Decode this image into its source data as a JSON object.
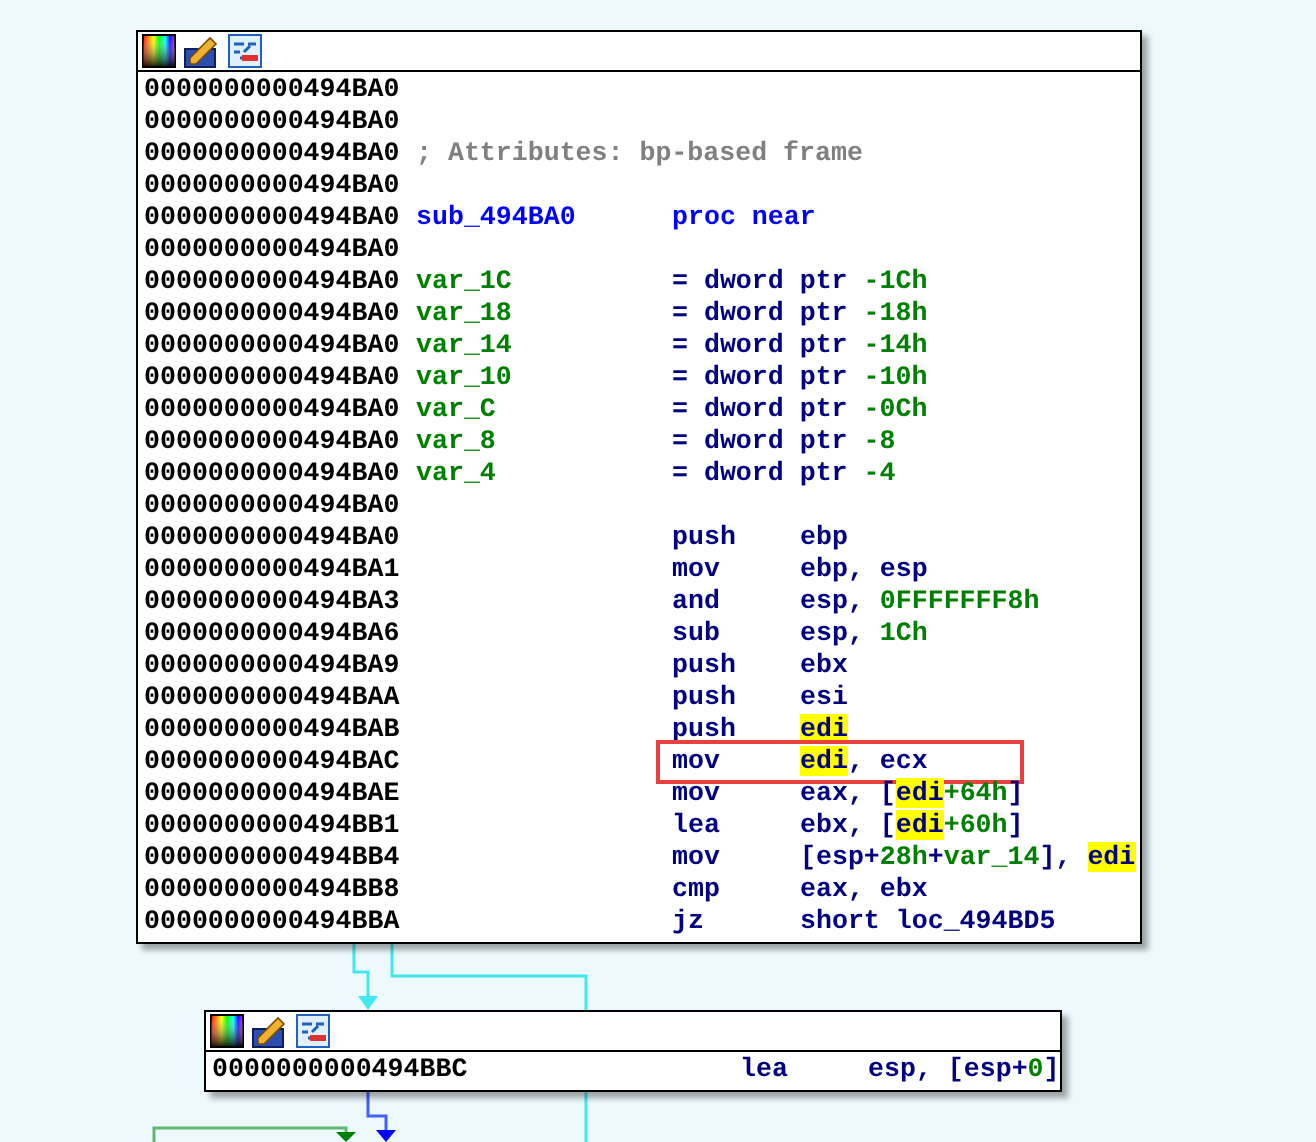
{
  "nodes": [
    {
      "lines": [
        {
          "kind": "blank",
          "address": "0000000000494BA0"
        },
        {
          "kind": "blank",
          "address": "0000000000494BA0"
        },
        {
          "kind": "comment",
          "address": "0000000000494BA0",
          "text": "; Attributes: bp-based frame"
        },
        {
          "kind": "blank",
          "address": "0000000000494BA0"
        },
        {
          "kind": "proc",
          "address": "0000000000494BA0",
          "label": "sub_494BA0",
          "directive": "proc near"
        },
        {
          "kind": "blank",
          "address": "0000000000494BA0"
        },
        {
          "kind": "var",
          "address": "0000000000494BA0",
          "label": "var_1C",
          "definition": "= dword ptr",
          "value": "-1Ch"
        },
        {
          "kind": "var",
          "address": "0000000000494BA0",
          "label": "var_18",
          "definition": "= dword ptr",
          "value": "-18h"
        },
        {
          "kind": "var",
          "address": "0000000000494BA0",
          "label": "var_14",
          "definition": "= dword ptr",
          "value": "-14h"
        },
        {
          "kind": "var",
          "address": "0000000000494BA0",
          "label": "var_10",
          "definition": "= dword ptr",
          "value": "-10h"
        },
        {
          "kind": "var",
          "address": "0000000000494BA0",
          "label": "var_C",
          "definition": "= dword ptr",
          "value": "-0Ch"
        },
        {
          "kind": "var",
          "address": "0000000000494BA0",
          "label": "var_8",
          "definition": "= dword ptr",
          "value": "-8"
        },
        {
          "kind": "var",
          "address": "0000000000494BA0",
          "label": "var_4",
          "definition": "= dword ptr",
          "value": "-4"
        },
        {
          "kind": "blank",
          "address": "0000000000494BA0"
        },
        {
          "kind": "insn",
          "address": "0000000000494BA0",
          "mnemonic": "push",
          "boxed": false,
          "operand": [
            {
              "kind": "reg",
              "text": "ebp",
              "highlighted": false
            }
          ]
        },
        {
          "kind": "insn",
          "address": "0000000000494BA1",
          "mnemonic": "mov",
          "boxed": false,
          "operand": [
            {
              "kind": "reg",
              "text": "ebp, esp",
              "highlighted": false
            }
          ]
        },
        {
          "kind": "insn",
          "address": "0000000000494BA3",
          "mnemonic": "and",
          "boxed": false,
          "operand": [
            {
              "kind": "reg",
              "text": "esp, ",
              "highlighted": false
            },
            {
              "kind": "num",
              "text": "0FFFFFFF8h",
              "highlighted": false
            }
          ]
        },
        {
          "kind": "insn",
          "address": "0000000000494BA6",
          "mnemonic": "sub",
          "boxed": false,
          "operand": [
            {
              "kind": "reg",
              "text": "esp, ",
              "highlighted": false
            },
            {
              "kind": "num",
              "text": "1Ch",
              "highlighted": false
            }
          ]
        },
        {
          "kind": "insn",
          "address": "0000000000494BA9",
          "mnemonic": "push",
          "boxed": false,
          "operand": [
            {
              "kind": "reg",
              "text": "ebx",
              "highlighted": false
            }
          ]
        },
        {
          "kind": "insn",
          "address": "0000000000494BAA",
          "mnemonic": "push",
          "boxed": false,
          "operand": [
            {
              "kind": "reg",
              "text": "esi",
              "highlighted": false
            }
          ]
        },
        {
          "kind": "insn",
          "address": "0000000000494BAB",
          "mnemonic": "push",
          "boxed": false,
          "operand": [
            {
              "kind": "reg",
              "text": "edi",
              "highlighted": true
            }
          ]
        },
        {
          "kind": "insn",
          "address": "0000000000494BAC",
          "mnemonic": "mov",
          "boxed": true,
          "operand": [
            {
              "kind": "reg",
              "text": "edi",
              "highlighted": true
            },
            {
              "kind": "reg",
              "text": ", ecx",
              "highlighted": false
            }
          ]
        },
        {
          "kind": "insn",
          "address": "0000000000494BAE",
          "mnemonic": "mov",
          "boxed": false,
          "operand": [
            {
              "kind": "reg",
              "text": "eax, [",
              "highlighted": false
            },
            {
              "kind": "reg",
              "text": "edi",
              "highlighted": true
            },
            {
              "kind": "num",
              "text": "+64h",
              "highlighted": false
            },
            {
              "kind": "reg",
              "text": "]",
              "highlighted": false
            }
          ]
        },
        {
          "kind": "insn",
          "address": "0000000000494BB1",
          "mnemonic": "lea",
          "boxed": false,
          "operand": [
            {
              "kind": "reg",
              "text": "ebx, [",
              "highlighted": false
            },
            {
              "kind": "reg",
              "text": "edi",
              "highlighted": true
            },
            {
              "kind": "num",
              "text": "+60h",
              "highlighted": false
            },
            {
              "kind": "reg",
              "text": "]",
              "highlighted": false
            }
          ]
        },
        {
          "kind": "insn",
          "address": "0000000000494BB4",
          "mnemonic": "mov",
          "boxed": false,
          "operand": [
            {
              "kind": "reg",
              "text": "[esp+",
              "highlighted": false
            },
            {
              "kind": "num",
              "text": "28h",
              "highlighted": false
            },
            {
              "kind": "reg",
              "text": "+",
              "highlighted": false
            },
            {
              "kind": "num",
              "text": "var_14",
              "highlighted": false
            },
            {
              "kind": "reg",
              "text": "], ",
              "highlighted": false
            },
            {
              "kind": "reg",
              "text": "edi",
              "highlighted": true
            }
          ]
        },
        {
          "kind": "insn",
          "address": "0000000000494BB8",
          "mnemonic": "cmp",
          "boxed": false,
          "operand": [
            {
              "kind": "reg",
              "text": "eax, ebx",
              "highlighted": false
            }
          ]
        },
        {
          "kind": "insn",
          "address": "0000000000494BBA",
          "mnemonic": "jz",
          "boxed": false,
          "operand": [
            {
              "kind": "reg",
              "text": "short loc_494BD5",
              "highlighted": false
            }
          ]
        }
      ]
    },
    {
      "lines": [
        {
          "kind": "insn",
          "address": "0000000000494BBC",
          "mnemonic": "lea",
          "boxed": false,
          "operand": [
            {
              "kind": "reg",
              "text": "esp, [esp+",
              "highlighted": false
            },
            {
              "kind": "num",
              "text": "0",
              "highlighted": false
            },
            {
              "kind": "reg",
              "text": "]",
              "highlighted": false
            }
          ]
        }
      ]
    }
  ]
}
